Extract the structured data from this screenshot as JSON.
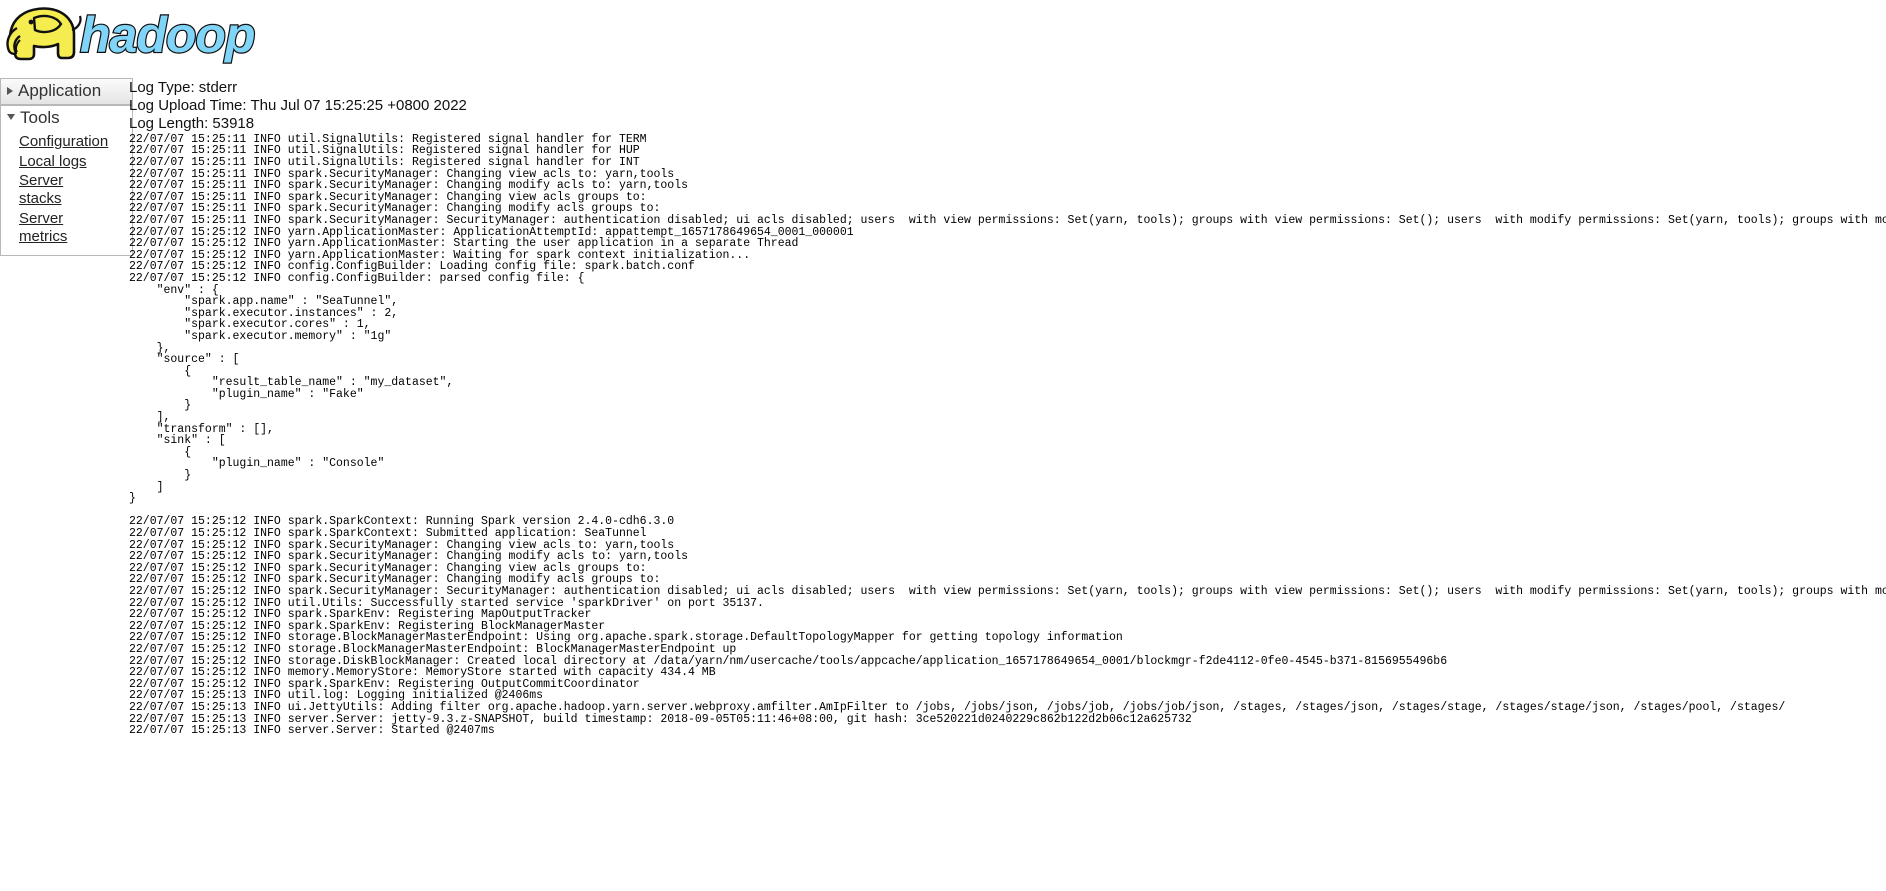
{
  "brand": {
    "name": "hadoop",
    "logo_alt": "hadoop-elephant-logo",
    "elephant_color": "#f5ec50",
    "text_color": "#7fd4f7"
  },
  "sidebar": {
    "sections": [
      {
        "label": "Application",
        "expanded": false,
        "icon": "chevron-right-icon",
        "items": []
      },
      {
        "label": "Tools",
        "expanded": true,
        "icon": "chevron-down-icon",
        "items": [
          {
            "label": "Configuration"
          },
          {
            "label": "Local logs"
          },
          {
            "label": "Server\nstacks"
          },
          {
            "label": "Server\nmetrics"
          }
        ]
      }
    ]
  },
  "log": {
    "type_label": "Log Type: stderr",
    "upload_time_label": "Log Upload Time: Thu Jul 07 15:25:25 +0800 2022",
    "length_label": "Log Length: 53918",
    "type_value": "stderr",
    "upload_time_value": "Thu Jul 07 15:25:25 +0800 2022",
    "length_value": "53918",
    "content": "22/07/07 15:25:11 INFO util.SignalUtils: Registered signal handler for TERM\n22/07/07 15:25:11 INFO util.SignalUtils: Registered signal handler for HUP\n22/07/07 15:25:11 INFO util.SignalUtils: Registered signal handler for INT\n22/07/07 15:25:11 INFO spark.SecurityManager: Changing view acls to: yarn,tools\n22/07/07 15:25:11 INFO spark.SecurityManager: Changing modify acls to: yarn,tools\n22/07/07 15:25:11 INFO spark.SecurityManager: Changing view acls groups to: \n22/07/07 15:25:11 INFO spark.SecurityManager: Changing modify acls groups to: \n22/07/07 15:25:11 INFO spark.SecurityManager: SecurityManager: authentication disabled; ui acls disabled; users  with view permissions: Set(yarn, tools); groups with view permissions: Set(); users  with modify permissions: Set(yarn, tools); groups with modify permissions: Set()\n22/07/07 15:25:12 INFO yarn.ApplicationMaster: ApplicationAttemptId: appattempt_1657178649654_0001_000001\n22/07/07 15:25:12 INFO yarn.ApplicationMaster: Starting the user application in a separate Thread\n22/07/07 15:25:12 INFO yarn.ApplicationMaster: Waiting for spark context initialization...\n22/07/07 15:25:12 INFO config.ConfigBuilder: Loading config file: spark.batch.conf\n22/07/07 15:25:12 INFO config.ConfigBuilder: parsed config file: {\n    \"env\" : {\n        \"spark.app.name\" : \"SeaTunnel\",\n        \"spark.executor.instances\" : 2,\n        \"spark.executor.cores\" : 1,\n        \"spark.executor.memory\" : \"1g\"\n    },\n    \"source\" : [\n        {\n            \"result_table_name\" : \"my_dataset\",\n            \"plugin_name\" : \"Fake\"\n        }\n    ],\n    \"transform\" : [],\n    \"sink\" : [\n        {\n            \"plugin_name\" : \"Console\"\n        }\n    ]\n}\n\n22/07/07 15:25:12 INFO spark.SparkContext: Running Spark version 2.4.0-cdh6.3.0\n22/07/07 15:25:12 INFO spark.SparkContext: Submitted application: SeaTunnel\n22/07/07 15:25:12 INFO spark.SecurityManager: Changing view acls to: yarn,tools\n22/07/07 15:25:12 INFO spark.SecurityManager: Changing modify acls to: yarn,tools\n22/07/07 15:25:12 INFO spark.SecurityManager: Changing view acls groups to: \n22/07/07 15:25:12 INFO spark.SecurityManager: Changing modify acls groups to: \n22/07/07 15:25:12 INFO spark.SecurityManager: SecurityManager: authentication disabled; ui acls disabled; users  with view permissions: Set(yarn, tools); groups with view permissions: Set(); users  with modify permissions: Set(yarn, tools); groups with modify permissions: Set()\n22/07/07 15:25:12 INFO util.Utils: Successfully started service 'sparkDriver' on port 35137.\n22/07/07 15:25:12 INFO spark.SparkEnv: Registering MapOutputTracker\n22/07/07 15:25:12 INFO spark.SparkEnv: Registering BlockManagerMaster\n22/07/07 15:25:12 INFO storage.BlockManagerMasterEndpoint: Using org.apache.spark.storage.DefaultTopologyMapper for getting topology information\n22/07/07 15:25:12 INFO storage.BlockManagerMasterEndpoint: BlockManagerMasterEndpoint up\n22/07/07 15:25:12 INFO storage.DiskBlockManager: Created local directory at /data/yarn/nm/usercache/tools/appcache/application_1657178649654_0001/blockmgr-f2de4112-0fe0-4545-b371-8156955496b6\n22/07/07 15:25:12 INFO memory.MemoryStore: MemoryStore started with capacity 434.4 MB\n22/07/07 15:25:12 INFO spark.SparkEnv: Registering OutputCommitCoordinator\n22/07/07 15:25:13 INFO util.log: Logging initialized @2406ms\n22/07/07 15:25:13 INFO ui.JettyUtils: Adding filter org.apache.hadoop.yarn.server.webproxy.amfilter.AmIpFilter to /jobs, /jobs/json, /jobs/job, /jobs/job/json, /stages, /stages/json, /stages/stage, /stages/stage/json, /stages/pool, /stages/\n22/07/07 15:25:13 INFO server.Server: jetty-9.3.z-SNAPSHOT, build timestamp: 2018-09-05T05:11:46+08:00, git hash: 3ce520221d0240229c862b122d2b06c12a625732\n22/07/07 15:25:13 INFO server.Server: Started @2407ms"
  }
}
